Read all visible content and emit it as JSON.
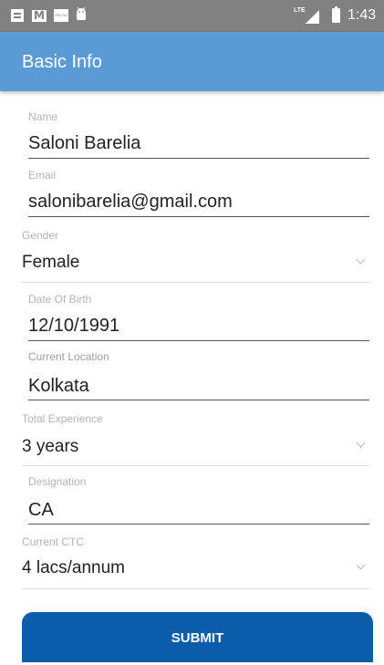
{
  "status_bar": {
    "notification_icons": [
      "notes-icon",
      "gmail-icon",
      "paytm-icon",
      "android-icon"
    ],
    "paytm_text": "PAYTM",
    "network": "LTE",
    "time": "1:43"
  },
  "app_bar": {
    "title": "Basic Info",
    "color": "#5b9bd5"
  },
  "form": {
    "name": {
      "label": "Name",
      "value": "Saloni Barelia"
    },
    "email": {
      "label": "Email",
      "value": "salonibarelia@gmail.com"
    },
    "gender": {
      "label": "Gender",
      "value": "Female"
    },
    "dob": {
      "label": "Date Of Birth",
      "value": "12/10/1991"
    },
    "location": {
      "label": "Current Location",
      "value": "Kolkata"
    },
    "experience": {
      "label": "Total Experience",
      "value": "3 years"
    },
    "designation": {
      "label": "Designation",
      "value": "CA"
    },
    "ctc": {
      "label": "Current CTC",
      "value": "4 lacs/annum"
    }
  },
  "submit": {
    "label": "SUBMIT",
    "color": "#0a5da8"
  }
}
